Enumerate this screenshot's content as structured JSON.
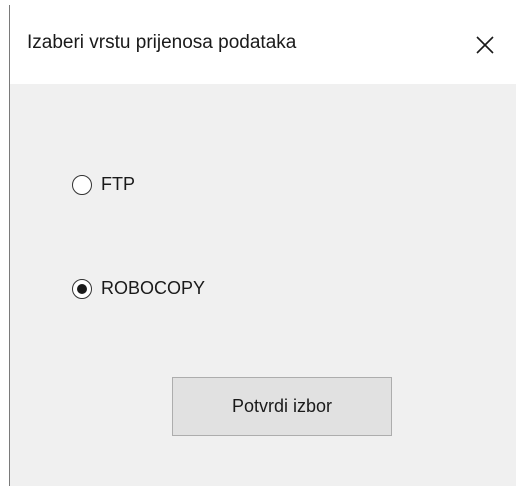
{
  "dialog": {
    "title": "Izaberi vrstu prijenosa podataka",
    "close_icon": "close-icon"
  },
  "options": [
    {
      "label": "FTP",
      "selected": false
    },
    {
      "label": "ROBOCOPY",
      "selected": true
    }
  ],
  "confirm_button": {
    "label": "Potvrdi izbor"
  }
}
